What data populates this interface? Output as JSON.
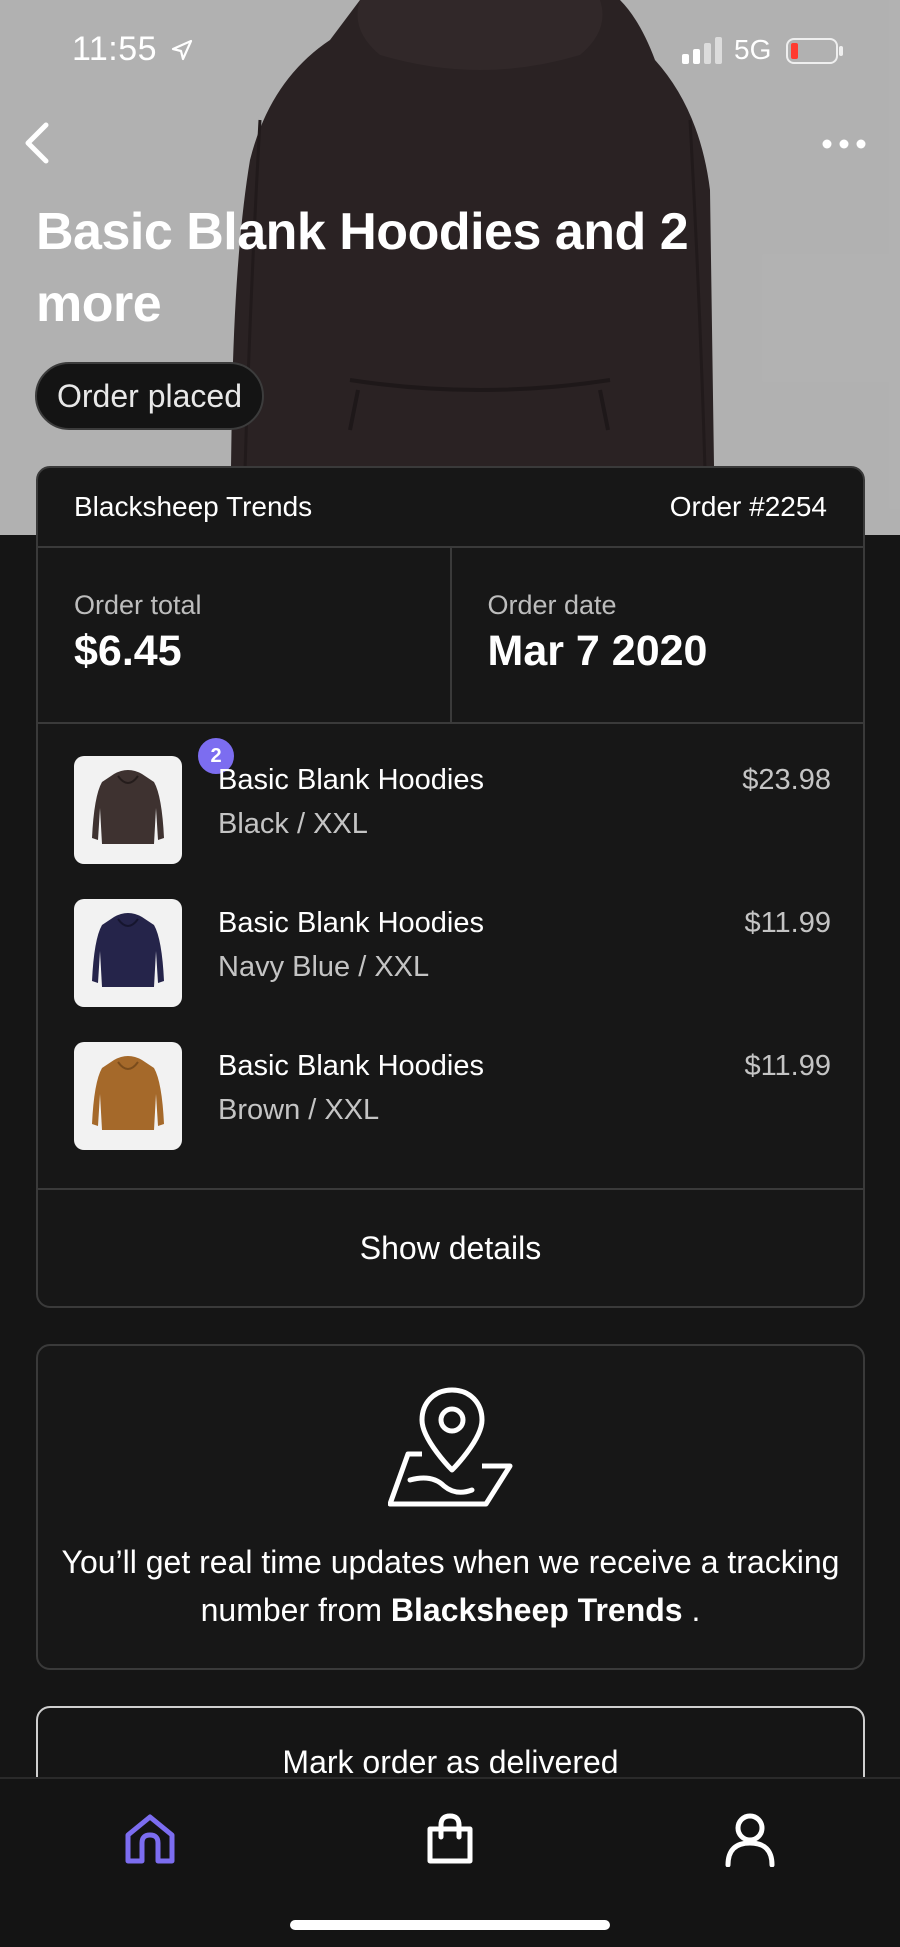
{
  "status_bar": {
    "time": "11:55",
    "network": "5G"
  },
  "header": {
    "title": "Basic Blank Hoodies and 2 more",
    "status": "Order placed"
  },
  "order": {
    "store": "Blacksheep Trends",
    "number": "Order #2254",
    "total_label": "Order total",
    "total_value": "$6.45",
    "date_label": "Order date",
    "date_value": "Mar 7 2020",
    "items": [
      {
        "name": "Basic Blank Hoodies",
        "variant": "Black / XXL",
        "price": "$23.98",
        "quantity": "2",
        "color": "#3e3230"
      },
      {
        "name": "Basic Blank Hoodies",
        "variant": "Navy Blue / XXL",
        "price": "$11.99",
        "color": "#25244a"
      },
      {
        "name": "Basic Blank Hoodies",
        "variant": "Brown / XXL",
        "price": "$11.99",
        "color": "#a5692a"
      }
    ],
    "show_details": "Show details"
  },
  "tracking": {
    "message_prefix": "You’ll get real time updates when we receive a tracking number from",
    "store": "Blacksheep Trends",
    "message_suffix": "."
  },
  "actions": {
    "mark_delivered": "Mark order as delivered"
  },
  "nav": {
    "items": [
      {
        "icon": "home-icon",
        "active": true
      },
      {
        "icon": "shopping-bag-icon",
        "active": false
      },
      {
        "icon": "profile-icon",
        "active": false
      }
    ]
  },
  "colors": {
    "accent": "#7c6df0",
    "background": "#151515",
    "card": "#171717"
  }
}
